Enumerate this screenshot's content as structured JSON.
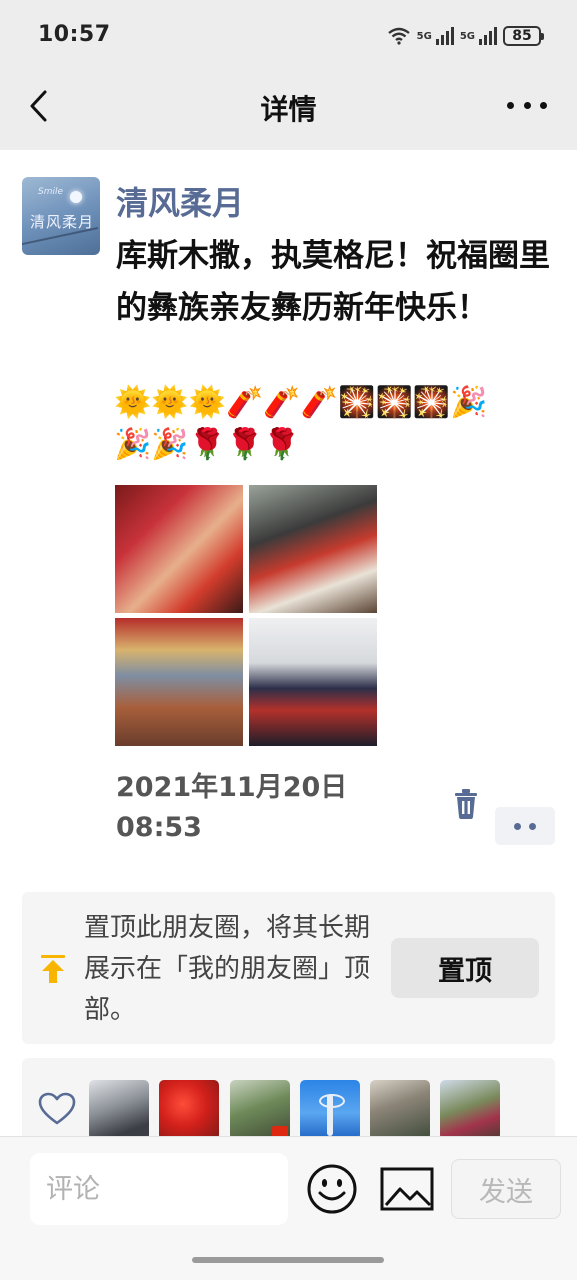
{
  "status_bar": {
    "time": "10:57",
    "network_1": "5G",
    "network_2": "5G",
    "battery": "85"
  },
  "nav": {
    "title": "详情"
  },
  "post": {
    "author": "清风柔月",
    "avatar_text": "清风柔月",
    "avatar_small_text": "Smile",
    "text": "库斯木撒，执莫格尼！祝福圈里的彝族亲友彝历新年快乐！",
    "emoji_line_1": "🌞🌞🌞🧨🧨🧨🎇🎇🎇🎉",
    "emoji_line_2": "🎉🎉🌹🌹🌹",
    "date": "2021年11月20日 08:53",
    "photo_count": 4
  },
  "pin": {
    "text": "置顶此朋友圈，将其长期展示在「我的朋友圈」顶部。",
    "button_label": "置顶"
  },
  "likes": {
    "liker_count": 6
  },
  "comment": {
    "placeholder": "评论",
    "send_label": "发送"
  },
  "colors": {
    "link_blue": "#576b95",
    "pin_arrow": "#f7b500",
    "background": "#ededed"
  },
  "icons": [
    "back-arrow-icon",
    "more-dots-icon",
    "trash-icon",
    "pin-arrow-icon",
    "heart-icon",
    "emoji-face-icon",
    "image-icon"
  ]
}
